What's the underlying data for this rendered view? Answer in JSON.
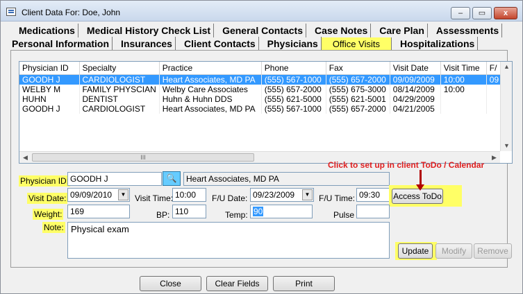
{
  "window": {
    "title": "Client Data For: Doe, John",
    "controls": [
      "–",
      "▭",
      "x"
    ]
  },
  "tabs_row1": [
    "Medications",
    "Medical History Check List",
    "General Contacts",
    "Case Notes",
    "Care Plan",
    "Assessments"
  ],
  "tabs_row2": [
    "Personal Information",
    "Insurances",
    "Client Contacts",
    "Physicians",
    "Office Visits",
    "Hospitalizations"
  ],
  "grid": {
    "columns": [
      "Physician ID",
      "Specialty",
      "Practice",
      "Phone",
      "Fax",
      "Visit Date",
      "Visit Time",
      "F/"
    ],
    "rows": [
      [
        "GOODH J",
        "CARDIOLOGIST",
        "Heart Associates, MD PA",
        "(555) 567-1000",
        "(555) 657-2000",
        "09/09/2009",
        "10:00",
        "09"
      ],
      [
        "WELBY M",
        "FAMILY PHYSCIAN",
        "Welby Care Associates",
        "(555) 657-2000",
        "(555) 675-3000",
        "08/14/2009",
        "10:00",
        ""
      ],
      [
        "HUHN",
        "DENTIST",
        "Huhn & Huhn DDS",
        "(555) 621-5000",
        "(555) 621-5001",
        "04/29/2009",
        "",
        ""
      ],
      [
        "GOODH J",
        "CARDIOLOGIST",
        "Heart Associates, MD PA",
        "(555) 567-1000",
        "(555) 657-2000",
        "04/21/2005",
        "",
        ""
      ]
    ],
    "scroll_thumb_text": "III"
  },
  "form": {
    "physician_id_label": "Physician ID:",
    "physician_id_value": "GOODH J",
    "practice_value": "Heart Associates, MD PA",
    "visit_date_label": "Visit Date:",
    "visit_date_value": "09/09/2010",
    "visit_time_label": "Visit Time:",
    "visit_time_value": "10:00",
    "fu_date_label": "F/U Date:",
    "fu_date_value": "09/23/2009",
    "fu_time_label": "F/U Time:",
    "fu_time_value": "09:30",
    "weight_label": "Weight:",
    "weight_value": "169",
    "bp_label": "BP:",
    "bp_value": "110",
    "temp_label": "Temp:",
    "temp_value": "90",
    "pulse_label": "Pulse",
    "pulse_value": "",
    "note_label": "Note:",
    "note_value": "Physical exam"
  },
  "buttons": {
    "access_todo": "Access ToDo",
    "update": "Update",
    "modify": "Modify",
    "remove": "Remove",
    "close": "Close",
    "clear_fields": "Clear Fields",
    "print": "Print"
  },
  "annotation": "Click to set up in client ToDo / Calendar",
  "colors": {
    "highlight": "#ffff66",
    "selection": "#3399ff",
    "annotation": "#e02020"
  },
  "icons": {
    "binoculars": "🔍"
  }
}
